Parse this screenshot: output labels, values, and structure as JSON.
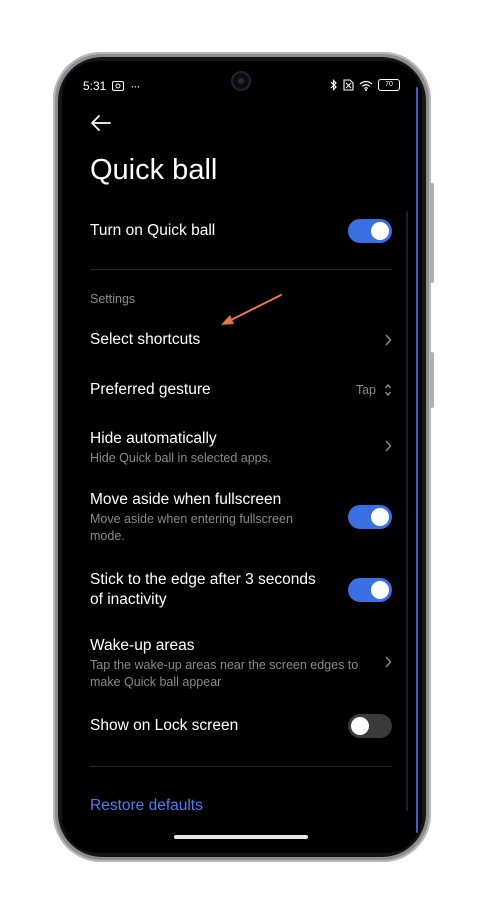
{
  "status_bar": {
    "time": "5:31",
    "battery": "70",
    "more": "···"
  },
  "page": {
    "title": "Quick ball"
  },
  "settings": {
    "turn_on": {
      "label": "Turn on Quick ball",
      "enabled": true
    },
    "section_label": "Settings",
    "select_shortcuts": {
      "label": "Select shortcuts"
    },
    "preferred_gesture": {
      "label": "Preferred gesture",
      "value": "Tap"
    },
    "hide_automatically": {
      "label": "Hide automatically",
      "sub": "Hide Quick ball in selected apps."
    },
    "move_aside": {
      "label": "Move aside when fullscreen",
      "sub": "Move aside when entering fullscreen mode.",
      "enabled": true
    },
    "stick_edge": {
      "label": "Stick to the edge after 3 seconds of inactivity",
      "enabled": true
    },
    "wake_up": {
      "label": "Wake-up areas",
      "sub": "Tap the wake-up areas near the screen edges to make Quick ball appear"
    },
    "lock_screen": {
      "label": "Show on Lock screen",
      "enabled": false
    },
    "restore": "Restore defaults"
  },
  "colors": {
    "accent": "#3b6fe4",
    "link": "#4c7fef",
    "annotation_arrow": "#e8744a"
  }
}
